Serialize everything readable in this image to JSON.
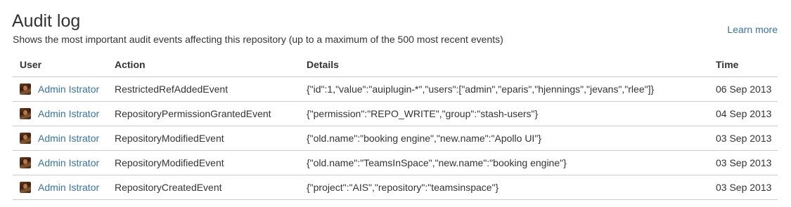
{
  "header": {
    "title": "Audit log",
    "subtitle": "Shows the most important audit events affecting this repository (up to a maximum of the 500 most recent events)",
    "learn_more": "Learn more"
  },
  "table": {
    "columns": [
      "User",
      "Action",
      "Details",
      "Time"
    ],
    "rows": [
      {
        "user": "Admin Istrator",
        "action": "RestrictedRefAddedEvent",
        "details": "{\"id\":1,\"value\":\"auiplugin-*\",\"users\":[\"admin\",\"eparis\",\"hjennings\",\"jevans\",\"rlee\"]}",
        "time": "06 Sep 2013"
      },
      {
        "user": "Admin Istrator",
        "action": "RepositoryPermissionGrantedEvent",
        "details": "{\"permission\":\"REPO_WRITE\",\"group\":\"stash-users\"}",
        "time": "04 Sep 2013"
      },
      {
        "user": "Admin Istrator",
        "action": "RepositoryModifiedEvent",
        "details": "{\"old.name\":\"booking engine\",\"new.name\":\"Apollo UI\"}",
        "time": "03 Sep 2013"
      },
      {
        "user": "Admin Istrator",
        "action": "RepositoryModifiedEvent",
        "details": "{\"old.name\":\"TeamsInSpace\",\"new.name\":\"booking engine\"}",
        "time": "03 Sep 2013"
      },
      {
        "user": "Admin Istrator",
        "action": "RepositoryCreatedEvent",
        "details": "{\"project\":\"AIS\",\"repository\":\"teamsinspace\"}",
        "time": "03 Sep 2013"
      }
    ]
  },
  "colors": {
    "link": "#3572b0",
    "text": "#333333",
    "border": "#cccccc"
  },
  "icons": {
    "avatar": "user-avatar-icon"
  }
}
